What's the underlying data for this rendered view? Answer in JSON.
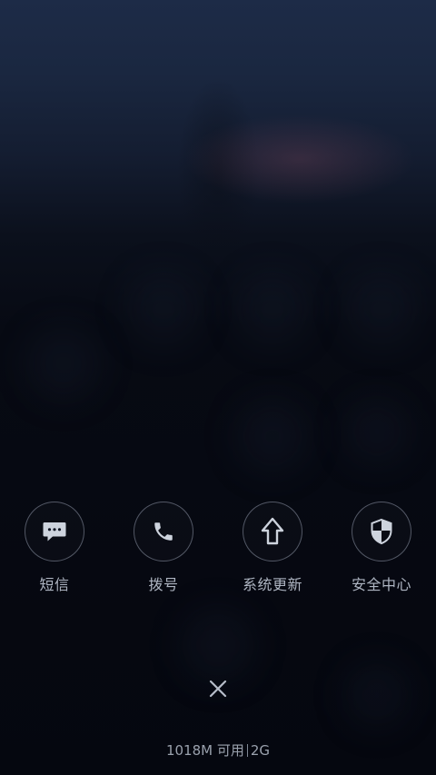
{
  "shortcuts": [
    {
      "label": "短信",
      "icon": "message-icon"
    },
    {
      "label": "拨号",
      "icon": "phone-icon"
    },
    {
      "label": "系统更新",
      "icon": "arrow-up-icon"
    },
    {
      "label": "安全中心",
      "icon": "shield-icon"
    }
  ],
  "status": {
    "memory": "1018M 可用",
    "network": "2G"
  },
  "colors": {
    "icon": "#cdd3dd",
    "label": "#aeb5c2",
    "ring": "#aab4c8"
  }
}
